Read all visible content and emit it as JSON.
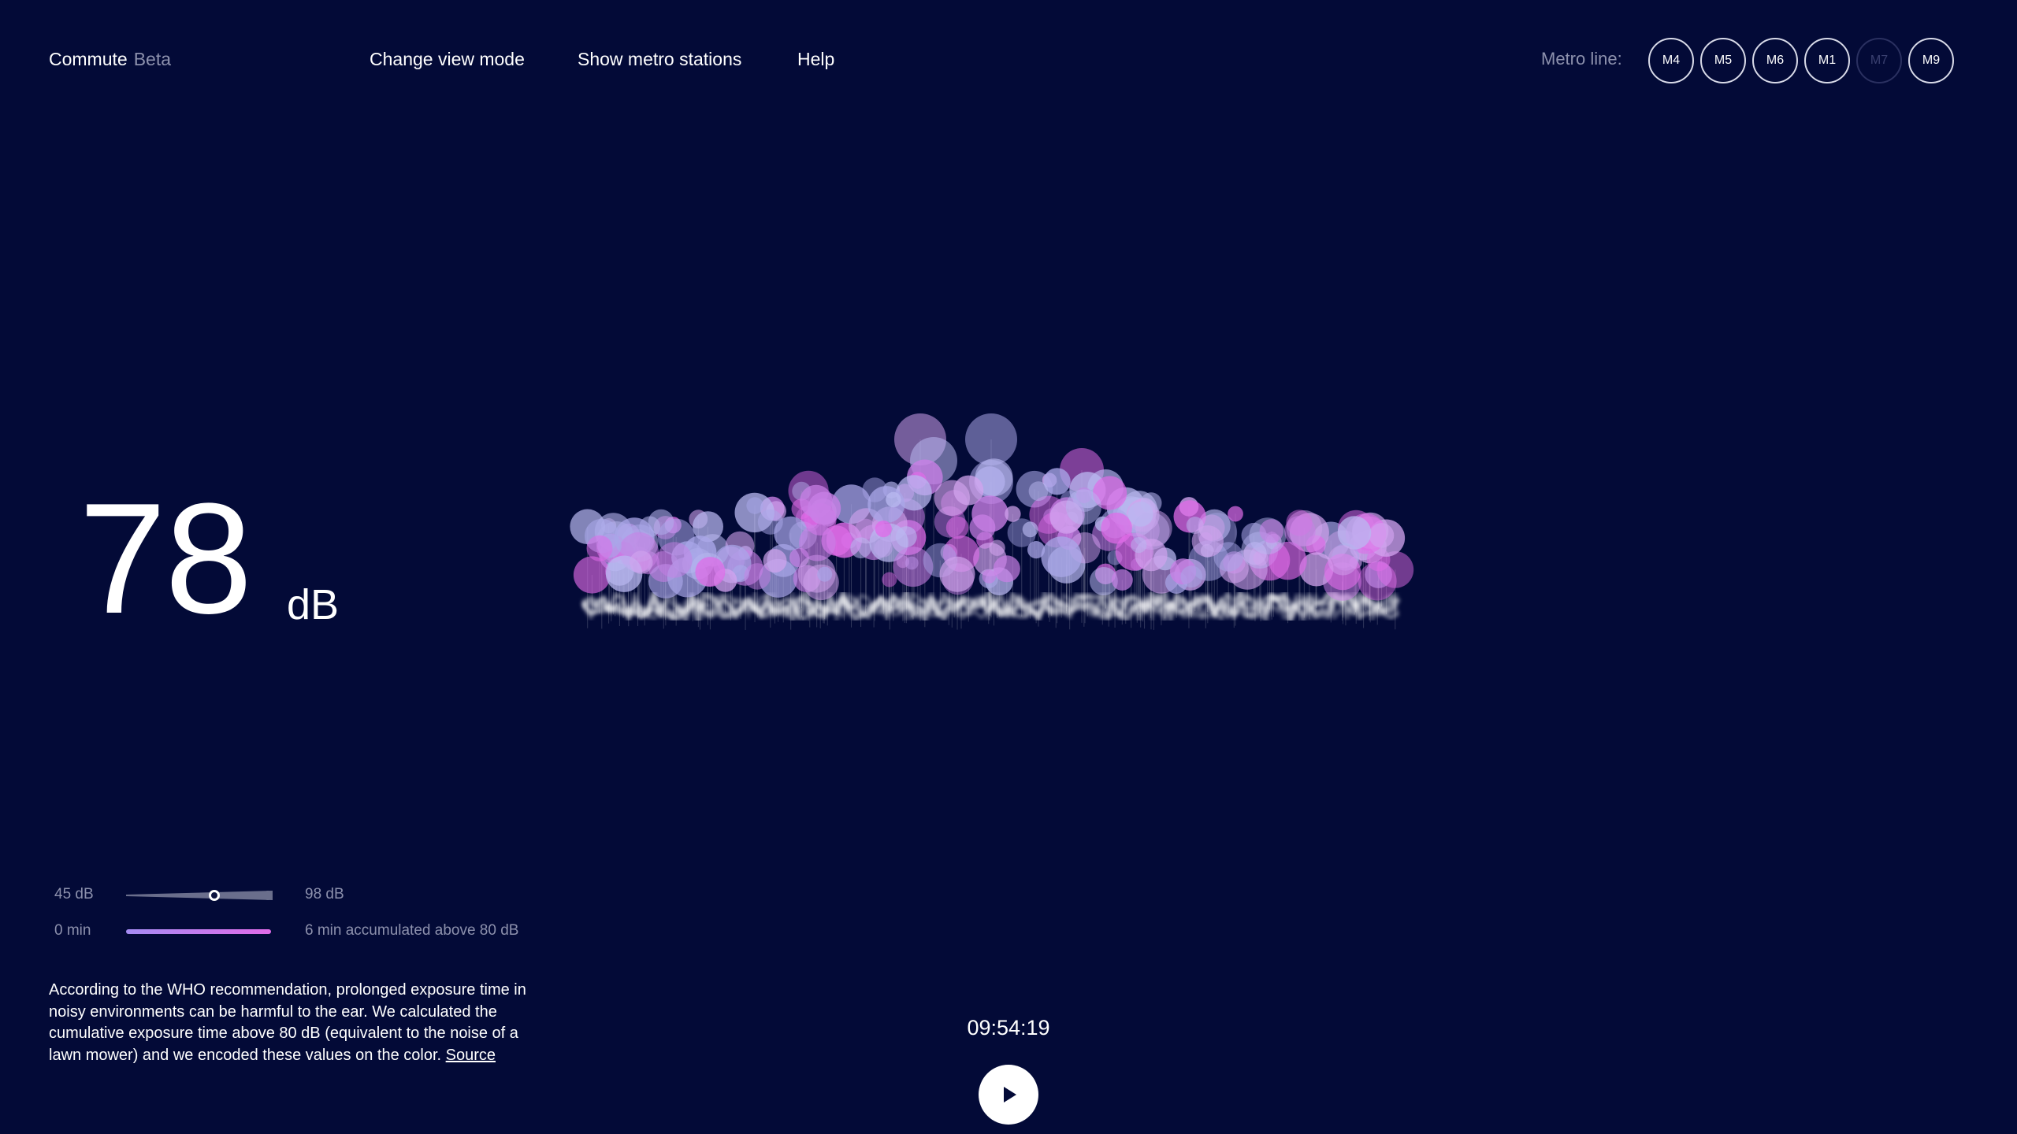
{
  "header": {
    "brand": "Commute",
    "brand_badge": "Beta",
    "nav": [
      "Change view mode",
      "Show metro stations",
      "Help"
    ],
    "metro_label": "Metro line:",
    "metro_lines": [
      {
        "label": "M4",
        "enabled": true
      },
      {
        "label": "M5",
        "enabled": true
      },
      {
        "label": "M6",
        "enabled": true
      },
      {
        "label": "M1",
        "enabled": true
      },
      {
        "label": "M7",
        "enabled": false
      },
      {
        "label": "M9",
        "enabled": true
      }
    ]
  },
  "reading": {
    "value": "78",
    "unit": "dB"
  },
  "legend": {
    "level_min": "45 dB",
    "level_max": "98 dB",
    "level_fraction": 0.6,
    "exposure_min": "0 min",
    "exposure_text": "6 min accumulated above 80 dB"
  },
  "note": {
    "text": "According to the WHO recommendation, prolonged exposure time in noisy environments can be harmful to the ear. We calculated the cumulative exposure time above 80 dB (equivalent to the noise of a lawn mower) and we encoded these values on the color.",
    "link": "Source"
  },
  "player": {
    "time": "09:54:19"
  },
  "colors": {
    "background": "#030a37",
    "accent_purple": "#c97fe6",
    "accent_lavender": "#b9b8f0",
    "accent_pink": "#e06be8"
  }
}
